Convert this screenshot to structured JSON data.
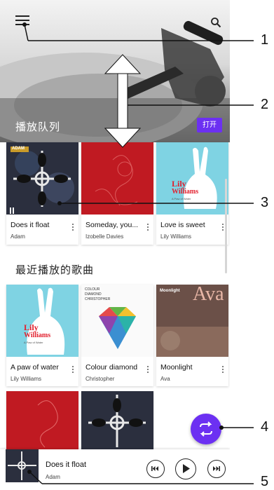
{
  "header": {
    "queue_title": "播放队列",
    "open_label": "打开"
  },
  "queue": [
    {
      "title": "Does it float",
      "artist": "Adam",
      "playing": true
    },
    {
      "title": "Someday, you...",
      "artist": "Izobelle Davies"
    },
    {
      "title": "Love is sweet",
      "artist": "Lily Williams"
    }
  ],
  "queue_art_text": {
    "card1_badge": "ADAM",
    "card3_line1": "Lily",
    "card3_line2": "Williams",
    "card3_line3": "A Paw of Water"
  },
  "recent": {
    "section_title": "最近播放的歌曲",
    "items": [
      {
        "title": "A paw of water",
        "artist": "Lily Williams"
      },
      {
        "title": "Colour diamond",
        "artist": "Christopher"
      },
      {
        "title": "Moonlight",
        "artist": "Ava"
      }
    ]
  },
  "recent_art_text": {
    "card4_line1": "Lily",
    "card4_line2": "Williams",
    "card4_line3": "A Paw of Water",
    "card5_line1": "COLOUR",
    "card5_line2": "DIAMOND",
    "card5_line3": "CHRISTOPHER",
    "card6_small": "Moonlight",
    "card6_big": "Ava"
  },
  "player": {
    "title": "Does it float",
    "artist": "Adam"
  },
  "callouts": [
    "1",
    "2",
    "3",
    "4",
    "5"
  ],
  "colors": {
    "accent": "#6c30f2",
    "red_art": "#c01a22",
    "teal_art": "#7fd3e3",
    "dark_art": "#2b2f3e"
  }
}
